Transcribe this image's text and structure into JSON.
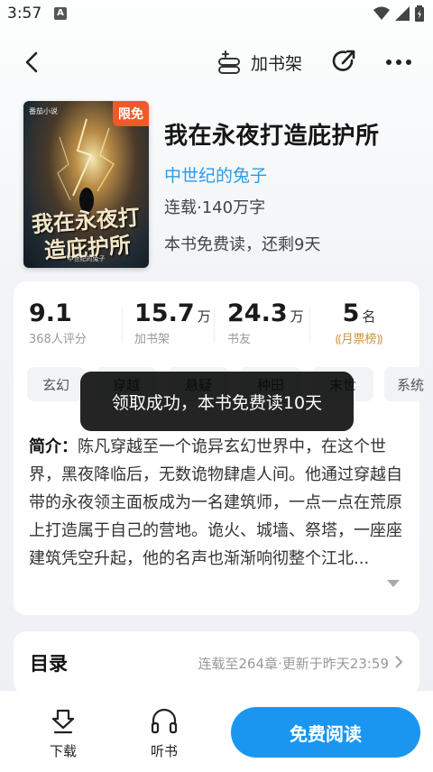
{
  "status_bar": {
    "time": "3:57",
    "notification_letter": "A"
  },
  "nav": {
    "add_shelf_label": "加书架"
  },
  "book": {
    "badge": "限免",
    "cover_title": "我在永夜打造庇护所",
    "cover_author": "中世纪的兔子",
    "cover_publisher": "番茄小说",
    "title": "我在永夜打造庇护所",
    "author": "中世纪的兔子",
    "status": "连载·140万字",
    "free_note": "本书免费读，还剩9天"
  },
  "stats": [
    {
      "value": "9.1",
      "unit": "",
      "label": "368人评分"
    },
    {
      "value": "15.7",
      "unit": "万",
      "label": "加书架"
    },
    {
      "value": "24.3",
      "unit": "万",
      "label": "书友"
    },
    {
      "value": "5",
      "unit": "名",
      "label": "月票榜"
    }
  ],
  "tags": [
    "玄幻",
    "穿越",
    "悬疑",
    "种田",
    "末世",
    "系统"
  ],
  "intro": {
    "label": "简介：",
    "text": "陈凡穿越至一个诡异玄幻世界中，在这个世界，黑夜降临后，无数诡物肆虐人间。他通过穿越自带的永夜领主面板成为一名建筑师，一点一点在荒原上打造属于自己的营地。诡火、城墙、祭塔，一座座建筑凭空升起，他的名声也渐渐响彻整个江北..."
  },
  "toast": "领取成功，本书免费读10天",
  "catalog": {
    "title": "目录",
    "meta": "连载至264章·更新于昨天23:59"
  },
  "bottom": {
    "download": "下载",
    "listen": "听书",
    "read": "免费阅读"
  },
  "colors": {
    "accent": "#1a96f0",
    "author": "#2a9be8",
    "badge": "#f05a28",
    "rank": "#c9924a"
  }
}
